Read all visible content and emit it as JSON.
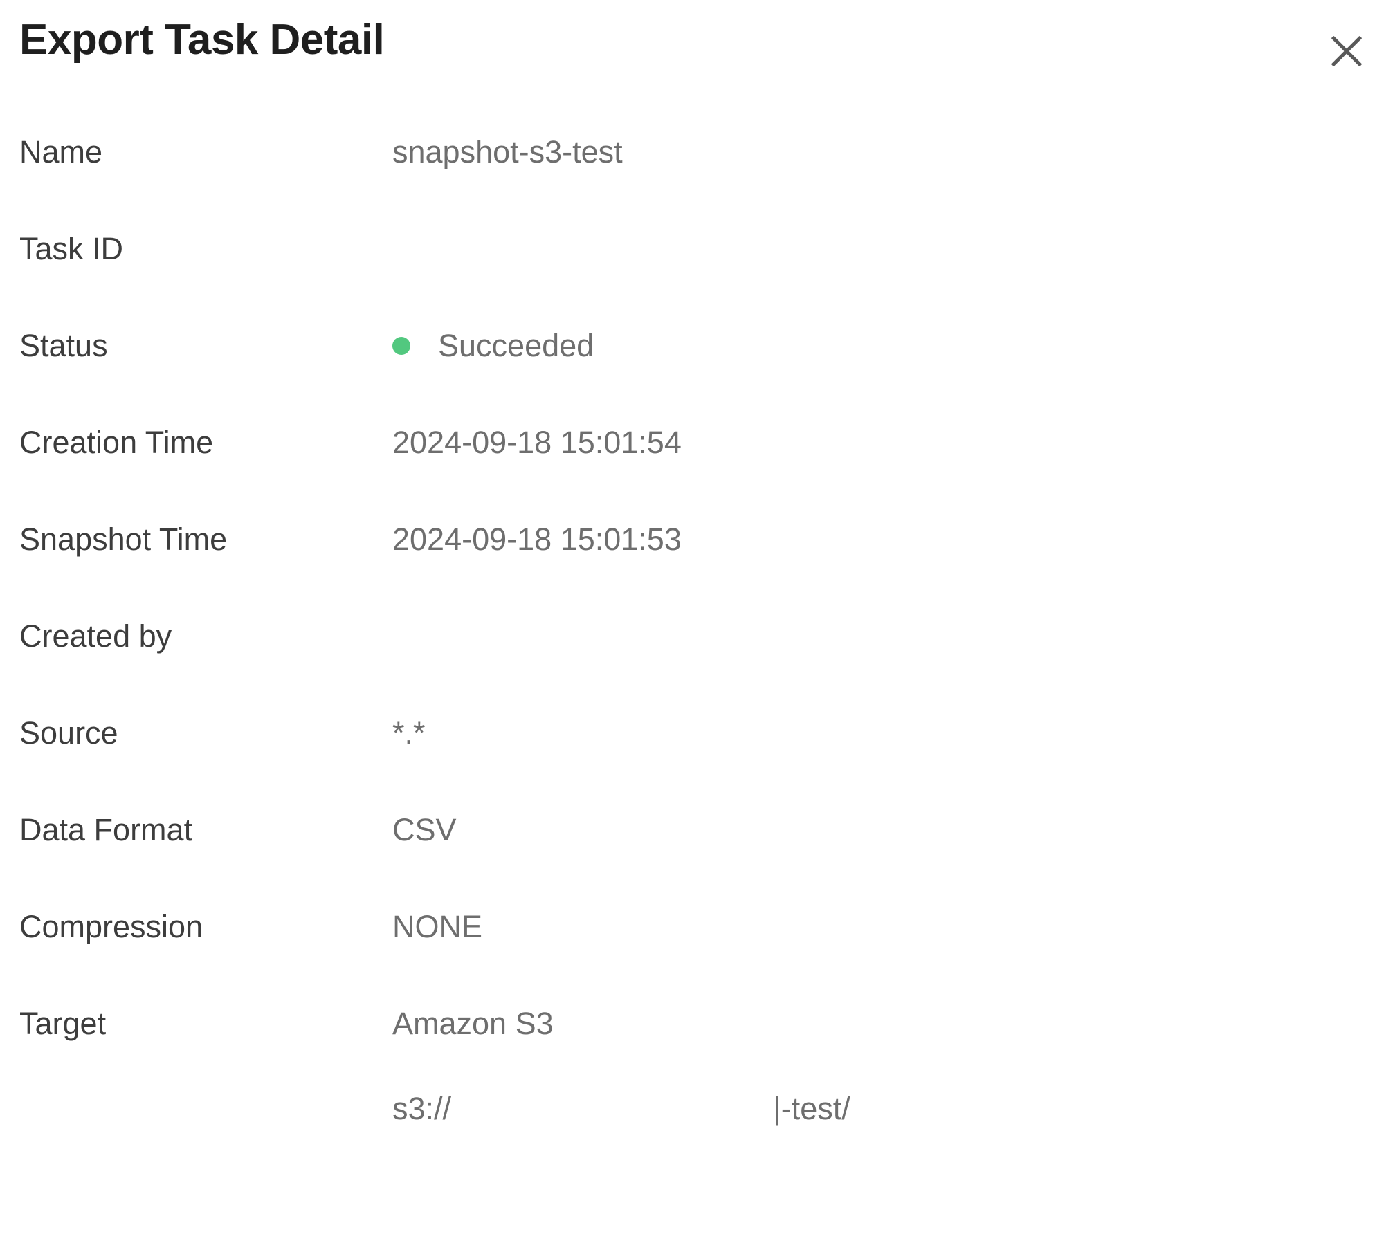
{
  "header": {
    "title": "Export Task Detail",
    "close_icon": "close-icon"
  },
  "details": {
    "rows": [
      {
        "label": "Name",
        "value": "snapshot-s3-test"
      },
      {
        "label": "Task ID",
        "value": ""
      },
      {
        "label": "Status",
        "value": "Succeeded"
      },
      {
        "label": "Creation Time",
        "value": "2024-09-18 15:01:54"
      },
      {
        "label": "Snapshot Time",
        "value": "2024-09-18 15:01:53"
      },
      {
        "label": "Created by",
        "value": ""
      },
      {
        "label": "Source",
        "value": "*.*"
      },
      {
        "label": "Data Format",
        "value": "CSV"
      },
      {
        "label": "Compression",
        "value": "NONE"
      },
      {
        "label": "Target",
        "value": "Amazon S3"
      }
    ],
    "status": {
      "label": "Status",
      "text": "Succeeded",
      "dot_color": "#52c87f",
      "dot_icon": "status-dot-icon"
    },
    "target": {
      "label": "Target",
      "service": "Amazon S3",
      "path_prefix": "s3://",
      "path_suffix": "|-test/"
    }
  },
  "colors": {
    "background": "#ffffff",
    "title": "#1f1f1f",
    "label": "#3d3d3d",
    "value": "#6e6e6e",
    "success": "#52c87f",
    "close_icon": "#595959"
  }
}
